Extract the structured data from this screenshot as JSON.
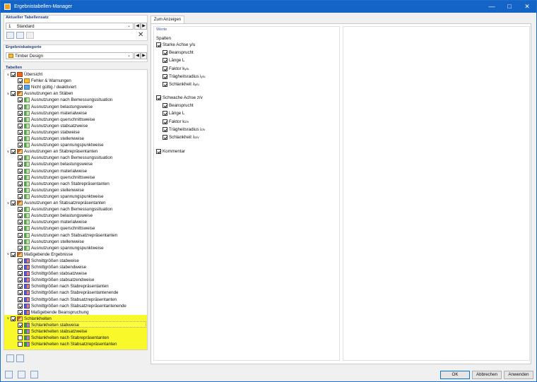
{
  "window": {
    "title": "Ergebnistabellen-Manager",
    "min_icon": "minimize-icon",
    "max_icon": "maximize-icon",
    "close_icon": "close-icon"
  },
  "left": {
    "current_set_label": "Aktueller Tabellensatz",
    "current_set": {
      "number": "1",
      "name": "Standard"
    },
    "category_label": "Ergebniskategorie",
    "category_value": "Timber Design",
    "tables_label": "Tabellen"
  },
  "tree": [
    {
      "level": 0,
      "label": "Übersicht",
      "checked": true,
      "expanded": true,
      "icon": "overview-icon"
    },
    {
      "level": 1,
      "label": "Fehler & Warnungen",
      "checked": true,
      "icon": "warning-icon"
    },
    {
      "level": 1,
      "label": "Nicht gültig / deaktiviert",
      "checked": true,
      "icon": "invalid-icon"
    },
    {
      "level": 0,
      "label": "Ausnutzungen an Stäben",
      "checked": true,
      "expanded": true,
      "icon": "member-icon"
    },
    {
      "level": 1,
      "label": "Ausnutzungen nach Bemessungssituation",
      "checked": true,
      "icon": "table-icon"
    },
    {
      "level": 1,
      "label": "Ausnutzungen belastungsweise",
      "checked": true,
      "icon": "table-icon"
    },
    {
      "level": 1,
      "label": "Ausnutzungen materialweise",
      "checked": true,
      "icon": "table-icon"
    },
    {
      "level": 1,
      "label": "Ausnutzungen querschnittsweise",
      "checked": true,
      "icon": "table-icon"
    },
    {
      "level": 1,
      "label": "Ausnutzungen stabsatzweise",
      "checked": true,
      "icon": "table-icon"
    },
    {
      "level": 1,
      "label": "Ausnutzungen stabweise",
      "checked": true,
      "icon": "table-icon"
    },
    {
      "level": 1,
      "label": "Ausnutzungen stellenweise",
      "checked": true,
      "icon": "table-icon"
    },
    {
      "level": 1,
      "label": "Ausnutzungen spannungspunktweise",
      "checked": true,
      "icon": "table-icon"
    },
    {
      "level": 0,
      "label": "Ausnutzungen an Stabrepräsentanten",
      "checked": true,
      "expanded": true,
      "icon": "member-icon"
    },
    {
      "level": 1,
      "label": "Ausnutzungen nach Bemessungssituation",
      "checked": true,
      "icon": "table-icon"
    },
    {
      "level": 1,
      "label": "Ausnutzungen belastungsweise",
      "checked": true,
      "icon": "table-icon"
    },
    {
      "level": 1,
      "label": "Ausnutzungen materialweise",
      "checked": true,
      "icon": "table-icon"
    },
    {
      "level": 1,
      "label": "Ausnutzungen querschnittsweise",
      "checked": true,
      "icon": "table-icon"
    },
    {
      "level": 1,
      "label": "Ausnutzungen nach Stabrepräsentanten",
      "checked": true,
      "icon": "table-icon"
    },
    {
      "level": 1,
      "label": "Ausnutzungen stellenweise",
      "checked": true,
      "icon": "table-icon"
    },
    {
      "level": 1,
      "label": "Ausnutzungen spannungspunktweise",
      "checked": true,
      "icon": "table-icon"
    },
    {
      "level": 0,
      "label": "Ausnutzungen an Stabsatzrepräsentanten",
      "checked": true,
      "expanded": true,
      "icon": "member-icon"
    },
    {
      "level": 1,
      "label": "Ausnutzungen nach Bemessungssituation",
      "checked": true,
      "icon": "table-icon"
    },
    {
      "level": 1,
      "label": "Ausnutzungen belastungsweise",
      "checked": true,
      "icon": "table-icon"
    },
    {
      "level": 1,
      "label": "Ausnutzungen materialweise",
      "checked": true,
      "icon": "table-icon"
    },
    {
      "level": 1,
      "label": "Ausnutzungen querschnittsweise",
      "checked": true,
      "icon": "table-icon"
    },
    {
      "level": 1,
      "label": "Ausnutzungen nach Stabsatzrepräsentanten",
      "checked": true,
      "icon": "table-icon"
    },
    {
      "level": 1,
      "label": "Ausnutzungen stellenweise",
      "checked": true,
      "icon": "table-icon"
    },
    {
      "level": 1,
      "label": "Ausnutzungen spannungspunktweise",
      "checked": true,
      "icon": "table-icon"
    },
    {
      "level": 0,
      "label": "Maßgebende Ergebnisse",
      "checked": true,
      "expanded": true,
      "icon": "member-icon"
    },
    {
      "level": 1,
      "label": "Schnittgrößen stabweise",
      "checked": true,
      "icon": "force-icon"
    },
    {
      "level": 1,
      "label": "Schnittgrößen stabendweise",
      "checked": true,
      "icon": "force-icon"
    },
    {
      "level": 1,
      "label": "Schnittgrößen stabsatzweise",
      "checked": true,
      "icon": "force-icon"
    },
    {
      "level": 1,
      "label": "Schnittgrößen stabsatzendweise",
      "checked": true,
      "icon": "force-icon"
    },
    {
      "level": 1,
      "label": "Schnittgrößen nach Stabrepräsentanten",
      "checked": true,
      "icon": "force-icon"
    },
    {
      "level": 1,
      "label": "Schnittgrößen nach Stabrepräsentantenende",
      "checked": true,
      "icon": "force-icon"
    },
    {
      "level": 1,
      "label": "Schnittgrößen nach Stabsatzrepräsentanten",
      "checked": true,
      "icon": "force-icon"
    },
    {
      "level": 1,
      "label": "Schnittgrößen nach Stabsatzrepräsentantenende",
      "checked": true,
      "icon": "force-icon"
    },
    {
      "level": 1,
      "label": "Maßgebende Beanspruchung",
      "checked": true,
      "icon": "force-icon"
    },
    {
      "level": 0,
      "label": "Schlankheiten",
      "checked": true,
      "expanded": true,
      "icon": "member-icon"
    },
    {
      "level": 1,
      "label": "Schlankheiten stabweise",
      "checked": true,
      "icon": "slenderness-icon",
      "selected": true
    },
    {
      "level": 1,
      "label": "Schlankheiten stabsatzweise",
      "checked": false,
      "icon": "slenderness-icon"
    },
    {
      "level": 1,
      "label": "Schlankheiten nach Stabrepräsentanten",
      "checked": false,
      "icon": "slenderness-icon"
    },
    {
      "level": 1,
      "label": "Schlankheiten nach Stabsatzrepräsentanten",
      "checked": false,
      "icon": "slenderness-icon"
    }
  ],
  "right": {
    "tab": "Zum Anzeigen",
    "values_label": "Werte",
    "columns_label": "Spalten",
    "strong_axis": {
      "label": "Starke Achse y/u",
      "items": [
        {
          "t": "Beansprucht"
        },
        {
          "t": "Länge L"
        },
        {
          "t": "Faktor k",
          "s": "y/u"
        },
        {
          "t": "Trägheitsradius i",
          "s": "y/u"
        },
        {
          "t": "Schlankheit λ",
          "s": "y/u"
        }
      ]
    },
    "weak_axis": {
      "label": "Schwache Achse z/v",
      "items": [
        {
          "t": "Beansprucht"
        },
        {
          "t": "Länge L"
        },
        {
          "t": "Faktor k",
          "s": "z/v"
        },
        {
          "t": "Trägheitsradius i",
          "s": "z/v"
        },
        {
          "t": "Schlankheit λ",
          "s": "z/v"
        }
      ]
    },
    "comment": "Kommentar"
  },
  "buttons": {
    "ok": "OK",
    "cancel": "Abbrechen",
    "apply": "Anwenden"
  }
}
